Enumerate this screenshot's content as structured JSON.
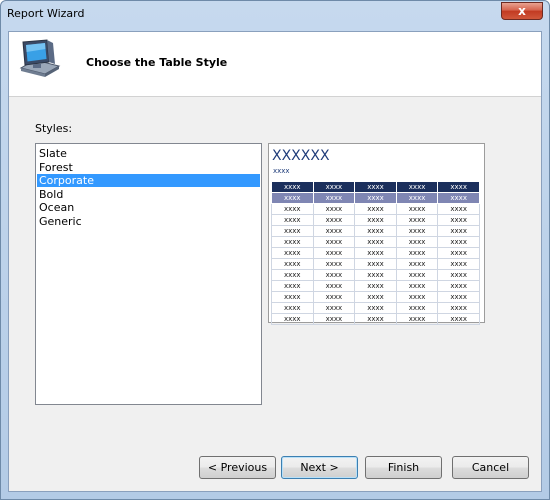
{
  "window": {
    "title": "Report Wizard",
    "close_glyph": "x"
  },
  "header": {
    "title": "Choose the Table Style",
    "icon": "computer-icon"
  },
  "styles": {
    "label": "Styles:",
    "items": [
      "Slate",
      "Forest",
      "Corporate",
      "Bold",
      "Ocean",
      "Generic"
    ],
    "selected": "Corporate"
  },
  "preview": {
    "title": "XXXXXX",
    "subtitle": "xxxx",
    "cell_text": "xxxx",
    "columns": 5,
    "rows": 13,
    "header_color": "#1b2f5c",
    "highlight_color": "#7f86b3"
  },
  "buttons": {
    "previous": "< Previous",
    "next": "Next >",
    "finish": "Finish",
    "cancel": "Cancel"
  },
  "colors": {
    "selection": "#3399ff",
    "window_frame": "#b3cbe6",
    "close": "#c23a22"
  }
}
